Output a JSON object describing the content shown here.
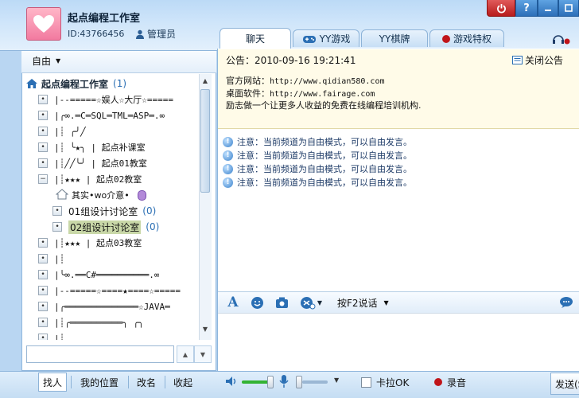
{
  "window": {
    "channel_name": "起点编程工作室",
    "channel_id_text": "ID:43766456",
    "role": "管理员",
    "help_label": "?"
  },
  "tabs": [
    {
      "label": "聊天",
      "active": true
    },
    {
      "label": "YY游戏",
      "active": false
    },
    {
      "label": "YY棋牌",
      "active": false
    },
    {
      "label": "游戏特权",
      "active": false
    }
  ],
  "left": {
    "mode_label": "自由",
    "root": {
      "label": "起点编程工作室",
      "count": "(1)"
    },
    "rows": [
      {
        "exp": "•",
        "text": "|--=====☆娱人☆大厅☆====="
      },
      {
        "exp": "•",
        "text": "|╭∞.═C═SQL═TML═ASP═.∞"
      },
      {
        "exp": "•",
        "text": "|┊ ╭╯╱"
      },
      {
        "exp": "•",
        "text": "|┊ ╰★╮  |  起点补课室"
      },
      {
        "exp": "•",
        "text": "|┊╱╱╰╯  |  起点01教室"
      },
      {
        "exp": "−",
        "text": "|┊★★★  |  起点02教室"
      },
      {
        "exp": "",
        "text": "其实•wo介意•",
        "is_user": true
      },
      {
        "exp": "•",
        "text": "01组设计讨论室",
        "count": "(0)",
        "indent": true
      },
      {
        "exp": "•",
        "text": "02组设计讨论室",
        "count": "(0)",
        "indent": true,
        "selected": true
      },
      {
        "exp": "•",
        "text": "|┊★★★  |  起点03教室"
      },
      {
        "exp": "•",
        "text": "|┊"
      },
      {
        "exp": "•",
        "text": "|╰∞.══C#══════════.∞"
      },
      {
        "exp": "•",
        "text": "|--=====☆====★====☆====="
      },
      {
        "exp": "•",
        "text": "|╭══════════════☆JAVA═"
      },
      {
        "exp": "•",
        "text": "|┊╭══════════╮ ╭╮"
      },
      {
        "exp": "•",
        "text": "|┊"
      }
    ],
    "search_placeholder": "",
    "bottom_tabs": [
      "找人",
      "我的位置",
      "改名",
      "收起"
    ]
  },
  "notice": {
    "title": "公告：2010-09-16 19:21:41",
    "close_label": "关闭公告",
    "lines": [
      {
        "label": "官方网站：",
        "value": "http://www.qidian580.com"
      },
      {
        "label": "桌面软件：",
        "value": "http://www.fairage.com"
      },
      {
        "label": "",
        "value": "励志做一个让更多人收益的免费在线编程培训机构."
      }
    ]
  },
  "messages": [
    "注意：当前频道为自由模式，可以自由发言。",
    "注意：当前频道为自由模式，可以自由发言。",
    "注意：当前频道为自由模式，可以自由发言。",
    "注意：当前频道为自由模式，可以自由发言。"
  ],
  "input": {
    "speak_mode": "按F2说话"
  },
  "bottom": {
    "karaoke_label": "卡拉OK",
    "record_label": "录音",
    "send_label": "发送(S)",
    "mic_volume_percent": 80,
    "speaker_volume_percent": 10
  },
  "colors": {
    "accent": "#2b6fb4",
    "record": "#c0151a",
    "volume": "#33b333"
  }
}
